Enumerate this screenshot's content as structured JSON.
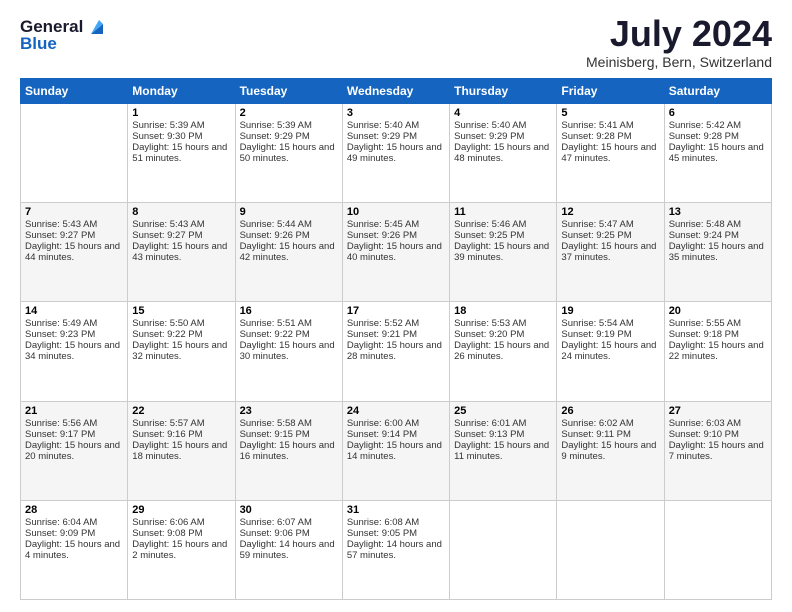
{
  "logo": {
    "general": "General",
    "blue": "Blue"
  },
  "header": {
    "month": "July 2024",
    "location": "Meinisberg, Bern, Switzerland"
  },
  "days": [
    "Sunday",
    "Monday",
    "Tuesday",
    "Wednesday",
    "Thursday",
    "Friday",
    "Saturday"
  ],
  "weeks": [
    [
      {
        "day": "",
        "sunrise": "",
        "sunset": "",
        "daylight": ""
      },
      {
        "day": "1",
        "sunrise": "Sunrise: 5:39 AM",
        "sunset": "Sunset: 9:30 PM",
        "daylight": "Daylight: 15 hours and 51 minutes."
      },
      {
        "day": "2",
        "sunrise": "Sunrise: 5:39 AM",
        "sunset": "Sunset: 9:29 PM",
        "daylight": "Daylight: 15 hours and 50 minutes."
      },
      {
        "day": "3",
        "sunrise": "Sunrise: 5:40 AM",
        "sunset": "Sunset: 9:29 PM",
        "daylight": "Daylight: 15 hours and 49 minutes."
      },
      {
        "day": "4",
        "sunrise": "Sunrise: 5:40 AM",
        "sunset": "Sunset: 9:29 PM",
        "daylight": "Daylight: 15 hours and 48 minutes."
      },
      {
        "day": "5",
        "sunrise": "Sunrise: 5:41 AM",
        "sunset": "Sunset: 9:28 PM",
        "daylight": "Daylight: 15 hours and 47 minutes."
      },
      {
        "day": "6",
        "sunrise": "Sunrise: 5:42 AM",
        "sunset": "Sunset: 9:28 PM",
        "daylight": "Daylight: 15 hours and 45 minutes."
      }
    ],
    [
      {
        "day": "7",
        "sunrise": "Sunrise: 5:43 AM",
        "sunset": "Sunset: 9:27 PM",
        "daylight": "Daylight: 15 hours and 44 minutes."
      },
      {
        "day": "8",
        "sunrise": "Sunrise: 5:43 AM",
        "sunset": "Sunset: 9:27 PM",
        "daylight": "Daylight: 15 hours and 43 minutes."
      },
      {
        "day": "9",
        "sunrise": "Sunrise: 5:44 AM",
        "sunset": "Sunset: 9:26 PM",
        "daylight": "Daylight: 15 hours and 42 minutes."
      },
      {
        "day": "10",
        "sunrise": "Sunrise: 5:45 AM",
        "sunset": "Sunset: 9:26 PM",
        "daylight": "Daylight: 15 hours and 40 minutes."
      },
      {
        "day": "11",
        "sunrise": "Sunrise: 5:46 AM",
        "sunset": "Sunset: 9:25 PM",
        "daylight": "Daylight: 15 hours and 39 minutes."
      },
      {
        "day": "12",
        "sunrise": "Sunrise: 5:47 AM",
        "sunset": "Sunset: 9:25 PM",
        "daylight": "Daylight: 15 hours and 37 minutes."
      },
      {
        "day": "13",
        "sunrise": "Sunrise: 5:48 AM",
        "sunset": "Sunset: 9:24 PM",
        "daylight": "Daylight: 15 hours and 35 minutes."
      }
    ],
    [
      {
        "day": "14",
        "sunrise": "Sunrise: 5:49 AM",
        "sunset": "Sunset: 9:23 PM",
        "daylight": "Daylight: 15 hours and 34 minutes."
      },
      {
        "day": "15",
        "sunrise": "Sunrise: 5:50 AM",
        "sunset": "Sunset: 9:22 PM",
        "daylight": "Daylight: 15 hours and 32 minutes."
      },
      {
        "day": "16",
        "sunrise": "Sunrise: 5:51 AM",
        "sunset": "Sunset: 9:22 PM",
        "daylight": "Daylight: 15 hours and 30 minutes."
      },
      {
        "day": "17",
        "sunrise": "Sunrise: 5:52 AM",
        "sunset": "Sunset: 9:21 PM",
        "daylight": "Daylight: 15 hours and 28 minutes."
      },
      {
        "day": "18",
        "sunrise": "Sunrise: 5:53 AM",
        "sunset": "Sunset: 9:20 PM",
        "daylight": "Daylight: 15 hours and 26 minutes."
      },
      {
        "day": "19",
        "sunrise": "Sunrise: 5:54 AM",
        "sunset": "Sunset: 9:19 PM",
        "daylight": "Daylight: 15 hours and 24 minutes."
      },
      {
        "day": "20",
        "sunrise": "Sunrise: 5:55 AM",
        "sunset": "Sunset: 9:18 PM",
        "daylight": "Daylight: 15 hours and 22 minutes."
      }
    ],
    [
      {
        "day": "21",
        "sunrise": "Sunrise: 5:56 AM",
        "sunset": "Sunset: 9:17 PM",
        "daylight": "Daylight: 15 hours and 20 minutes."
      },
      {
        "day": "22",
        "sunrise": "Sunrise: 5:57 AM",
        "sunset": "Sunset: 9:16 PM",
        "daylight": "Daylight: 15 hours and 18 minutes."
      },
      {
        "day": "23",
        "sunrise": "Sunrise: 5:58 AM",
        "sunset": "Sunset: 9:15 PM",
        "daylight": "Daylight: 15 hours and 16 minutes."
      },
      {
        "day": "24",
        "sunrise": "Sunrise: 6:00 AM",
        "sunset": "Sunset: 9:14 PM",
        "daylight": "Daylight: 15 hours and 14 minutes."
      },
      {
        "day": "25",
        "sunrise": "Sunrise: 6:01 AM",
        "sunset": "Sunset: 9:13 PM",
        "daylight": "Daylight: 15 hours and 11 minutes."
      },
      {
        "day": "26",
        "sunrise": "Sunrise: 6:02 AM",
        "sunset": "Sunset: 9:11 PM",
        "daylight": "Daylight: 15 hours and 9 minutes."
      },
      {
        "day": "27",
        "sunrise": "Sunrise: 6:03 AM",
        "sunset": "Sunset: 9:10 PM",
        "daylight": "Daylight: 15 hours and 7 minutes."
      }
    ],
    [
      {
        "day": "28",
        "sunrise": "Sunrise: 6:04 AM",
        "sunset": "Sunset: 9:09 PM",
        "daylight": "Daylight: 15 hours and 4 minutes."
      },
      {
        "day": "29",
        "sunrise": "Sunrise: 6:06 AM",
        "sunset": "Sunset: 9:08 PM",
        "daylight": "Daylight: 15 hours and 2 minutes."
      },
      {
        "day": "30",
        "sunrise": "Sunrise: 6:07 AM",
        "sunset": "Sunset: 9:06 PM",
        "daylight": "Daylight: 14 hours and 59 minutes."
      },
      {
        "day": "31",
        "sunrise": "Sunrise: 6:08 AM",
        "sunset": "Sunset: 9:05 PM",
        "daylight": "Daylight: 14 hours and 57 minutes."
      },
      {
        "day": "",
        "sunrise": "",
        "sunset": "",
        "daylight": ""
      },
      {
        "day": "",
        "sunrise": "",
        "sunset": "",
        "daylight": ""
      },
      {
        "day": "",
        "sunrise": "",
        "sunset": "",
        "daylight": ""
      }
    ]
  ]
}
